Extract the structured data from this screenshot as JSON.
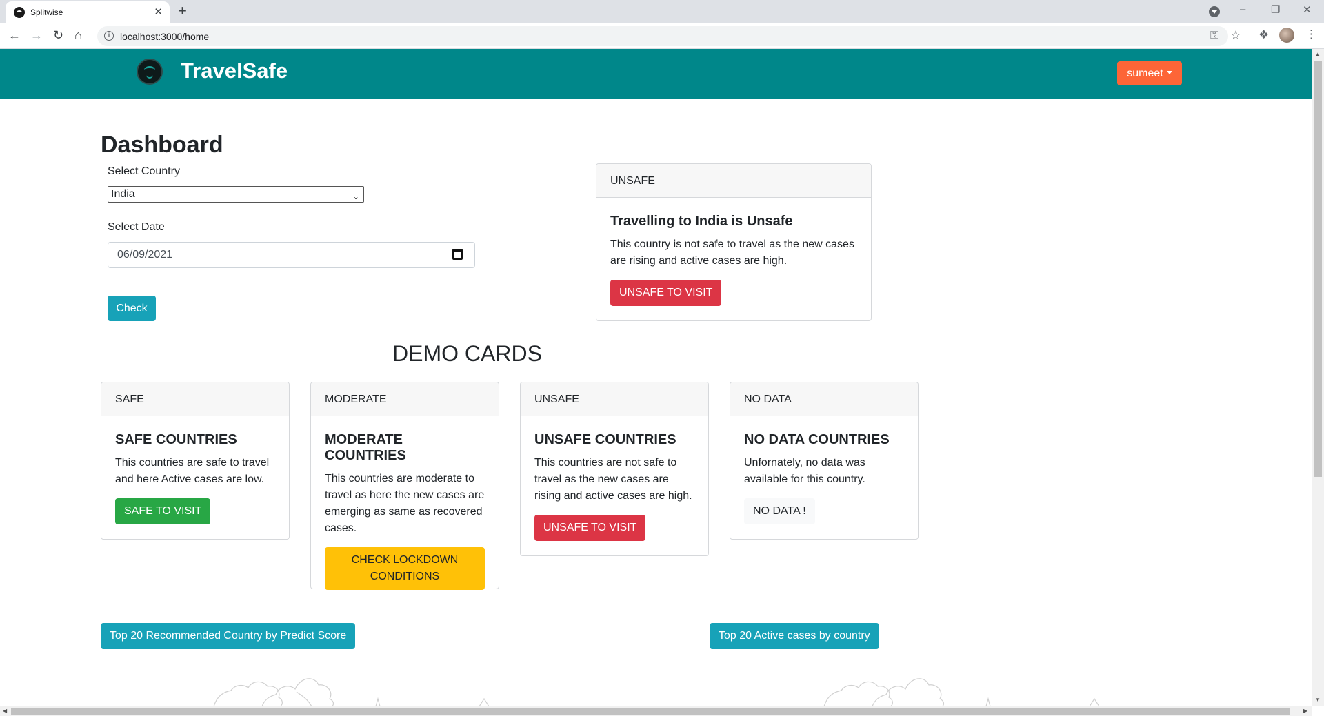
{
  "browser": {
    "tab_title": "Splitwise",
    "tab_close": "✕",
    "new_tab": "+",
    "url": "localhost:3000/home",
    "window_controls": [
      "–",
      "❐",
      "✕"
    ]
  },
  "navbar": {
    "brand": "TravelSafe",
    "user_menu": "sumeet",
    "bg_color": "#00878a",
    "user_btn_color": "#fd6537"
  },
  "dashboard": {
    "title": "Dashboard",
    "country_label": "Select Country",
    "country_value": "India",
    "date_label": "Select Date",
    "date_value": "06/09/2021",
    "check_button": "Check"
  },
  "result_card": {
    "header": "UNSAFE",
    "title": "Travelling to India is Unsafe",
    "text": "This country is not safe to travel as the new cases are rising and active cases are high.",
    "button": "UNSAFE TO VISIT"
  },
  "demo": {
    "title": "DEMO CARDS",
    "cards": [
      {
        "header": "SAFE",
        "title": "SAFE COUNTRIES",
        "text": "This countries are safe to travel and here Active cases are low.",
        "button": "SAFE TO VISIT",
        "button_color": "#28a745"
      },
      {
        "header": "MODERATE",
        "title": "MODERATE COUNTRIES",
        "text": "This countries are moderate to travel as here the new cases are emerging as same as recovered cases.",
        "button": "CHECK LOCKDOWN CONDITIONS",
        "button_color": "#ffc107"
      },
      {
        "header": "UNSAFE",
        "title": "UNSAFE COUNTRIES",
        "text": "This countries are not safe to travel as the new cases are rising and active cases are high.",
        "button": "UNSAFE TO VISIT",
        "button_color": "#dc3545"
      },
      {
        "header": "NO DATA",
        "title": "NO DATA COUNTRIES",
        "text": "Unfornately, no data was available for this country.",
        "button": "NO DATA !",
        "button_color": "#f8f9fa"
      }
    ]
  },
  "footer_buttons": {
    "recommended": "Top 20 Recommended Country by Predict Score",
    "active": "Top 20 Active cases by country"
  }
}
